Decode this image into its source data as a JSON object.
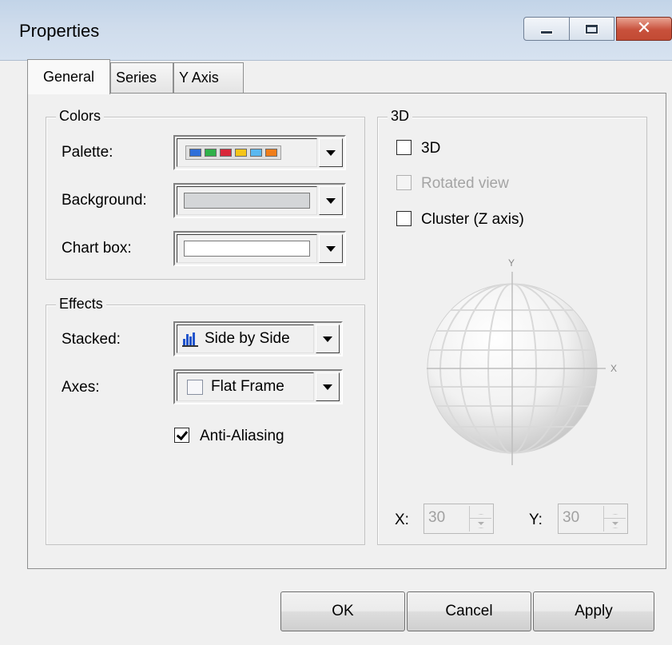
{
  "window": {
    "title": "Properties"
  },
  "icons": {
    "minimize": "minimize-icon",
    "maximize": "maximize-icon",
    "close": "close-icon"
  },
  "tabs": [
    {
      "label": "General",
      "active": true
    },
    {
      "label": "Series",
      "active": false
    },
    {
      "label": "Y Axis",
      "active": false
    }
  ],
  "colors_group": {
    "title": "Colors",
    "palette_label": "Palette:",
    "palette_swatches": [
      "#2f6fd9",
      "#2fb14a",
      "#d9283a",
      "#f5c518",
      "#5ab8f0",
      "#f07d1a"
    ],
    "background_label": "Background:",
    "background_color": "#d4d6d8",
    "chartbox_label": "Chart box:",
    "chartbox_color": "#ffffff"
  },
  "effects_group": {
    "title": "Effects",
    "stacked_label": "Stacked:",
    "stacked_value": "Side by Side",
    "axes_label": "Axes:",
    "axes_value": "Flat Frame",
    "antialias_label": "Anti-Aliasing",
    "antialias_checked": true
  },
  "threed_group": {
    "title": "3D",
    "threed_label": "3D",
    "threed_checked": false,
    "rotated_label": "Rotated view",
    "rotated_enabled": false,
    "cluster_label": "Cluster (Z axis)",
    "cluster_checked": false,
    "sphere_y_label": "Y",
    "sphere_x_label": "X",
    "x_label": "X:",
    "x_value": "30",
    "y_label": "Y:",
    "y_value": "30"
  },
  "buttons": {
    "ok": "OK",
    "cancel": "Cancel",
    "apply": "Apply"
  }
}
